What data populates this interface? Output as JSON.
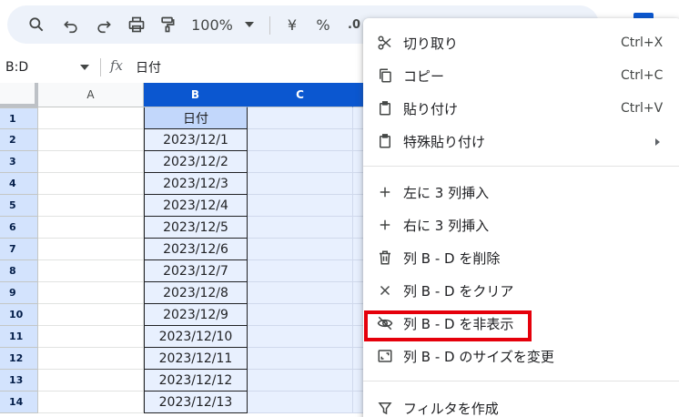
{
  "toolbar": {
    "zoom": "100%",
    "currency_symbol": "¥",
    "percent_symbol": "%",
    "decimal_symbol": ".0"
  },
  "formula_bar": {
    "name_box": "B:D",
    "fx_label": "fx",
    "value": "日付"
  },
  "sheet": {
    "columns": [
      "A",
      "B",
      "C"
    ],
    "rows": [
      {
        "num": "1",
        "b": "日付"
      },
      {
        "num": "2",
        "b": "2023/12/1"
      },
      {
        "num": "3",
        "b": "2023/12/2"
      },
      {
        "num": "4",
        "b": "2023/12/3"
      },
      {
        "num": "5",
        "b": "2023/12/4"
      },
      {
        "num": "6",
        "b": "2023/12/5"
      },
      {
        "num": "7",
        "b": "2023/12/6"
      },
      {
        "num": "8",
        "b": "2023/12/7"
      },
      {
        "num": "9",
        "b": "2023/12/8"
      },
      {
        "num": "10",
        "b": "2023/12/9"
      },
      {
        "num": "11",
        "b": "2023/12/10"
      },
      {
        "num": "12",
        "b": "2023/12/11"
      },
      {
        "num": "13",
        "b": "2023/12/12"
      },
      {
        "num": "14",
        "b": "2023/12/13"
      }
    ]
  },
  "context_menu": {
    "items": [
      {
        "label": "切り取り",
        "shortcut": "Ctrl+X",
        "icon": "scissors-icon"
      },
      {
        "label": "コピー",
        "shortcut": "Ctrl+C",
        "icon": "copy-icon"
      },
      {
        "label": "貼り付け",
        "shortcut": "Ctrl+V",
        "icon": "clipboard-icon"
      },
      {
        "label": "特殊貼り付け",
        "icon": "clipboard-icon"
      },
      {
        "label": "左に 3 列挿入",
        "icon": "plus-icon"
      },
      {
        "label": "右に 3 列挿入",
        "icon": "plus-icon"
      },
      {
        "label": "列 B - D を削除",
        "icon": "trash-icon"
      },
      {
        "label": "列 B - D をクリア",
        "icon": "x-icon"
      },
      {
        "label": "列 B - D を非表示",
        "icon": "eye-off-icon"
      },
      {
        "label": "列 B - D のサイズを変更",
        "icon": "resize-icon"
      },
      {
        "label": "フィルタを作成",
        "icon": "filter-icon"
      }
    ]
  },
  "colors": {
    "accent": "#0b57d0",
    "selection_fill": "#e8f0fe",
    "highlight_box": "#e5000b"
  }
}
